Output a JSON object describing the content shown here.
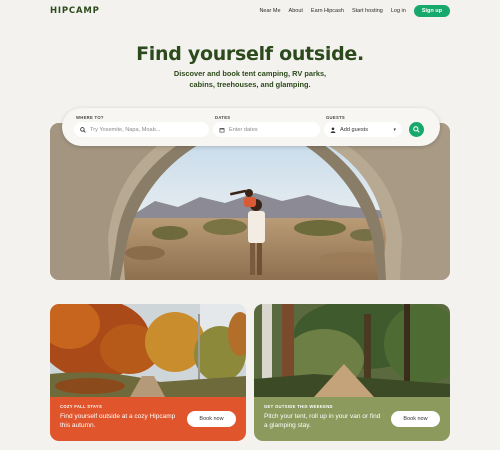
{
  "brand": "HIPCAMP",
  "nav": {
    "links": [
      "Near Me",
      "About",
      "Earn Hipcash",
      "Start hosting",
      "Log in"
    ],
    "signup": "Sign up"
  },
  "hero": {
    "title": "Find yourself outside.",
    "subtitle": "Discover and book tent camping, RV parks, cabins, treehouses, and glamping."
  },
  "search": {
    "where_label": "WHERE TO?",
    "where_placeholder": "Try Yosemite, Napa, Moab...",
    "dates_label": "DATES",
    "dates_placeholder": "Enter dates",
    "guests_label": "GUESTS",
    "guests_value": "Add guests"
  },
  "cards": [
    {
      "eyebrow": "COZY FALL STAYS",
      "title": "Find yourself outside at a cozy Hipcamp this autumn.",
      "button": "Book now",
      "color": "#e0552b"
    },
    {
      "eyebrow": "GET OUTSIDE THIS WEEKEND",
      "title": "Pitch your tent, roll up in your van or find a glamping stay.",
      "button": "Book now",
      "color": "#8c9a5e"
    }
  ],
  "colors": {
    "brand_green": "#2d4a1d",
    "accent": "#17a86b"
  }
}
